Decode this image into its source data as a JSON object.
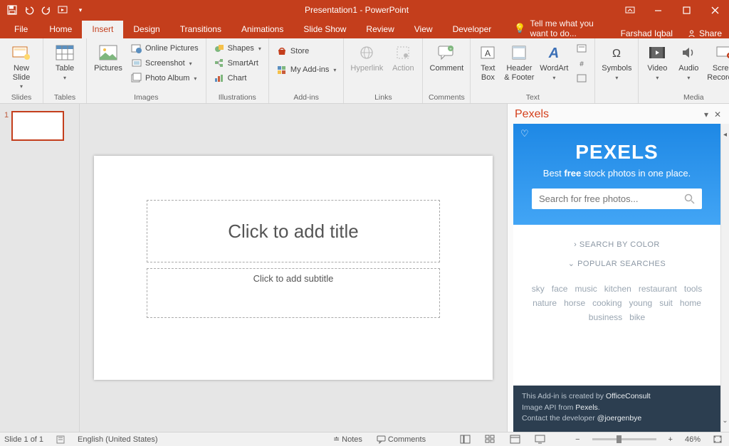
{
  "title": "Presentation1 - PowerPoint",
  "qat": {
    "save": "",
    "undo": "",
    "redo": "",
    "start": ""
  },
  "win": {
    "ribopts": "▾"
  },
  "tabs": {
    "file": "File",
    "list": [
      {
        "label": "Home"
      },
      {
        "label": "Insert"
      },
      {
        "label": "Design"
      },
      {
        "label": "Transitions"
      },
      {
        "label": "Animations"
      },
      {
        "label": "Slide Show"
      },
      {
        "label": "Review"
      },
      {
        "label": "View"
      },
      {
        "label": "Developer"
      }
    ],
    "active": 1,
    "tellme": "Tell me what you want to do...",
    "user": "Farshad Iqbal",
    "share": "Share"
  },
  "ribbon": {
    "slides": {
      "label": "Slides",
      "newSlide": "New Slide"
    },
    "tables": {
      "label": "Tables",
      "table": "Table"
    },
    "images": {
      "label": "Images",
      "pictures": "Pictures",
      "online": "Online Pictures",
      "screenshot": "Screenshot",
      "album": "Photo Album"
    },
    "illus": {
      "label": "Illustrations",
      "shapes": "Shapes",
      "smartart": "SmartArt",
      "chart": "Chart"
    },
    "addins": {
      "label": "Add-ins",
      "store": "Store",
      "myaddins": "My Add-ins"
    },
    "links": {
      "label": "Links",
      "hyperlink": "Hyperlink",
      "action": "Action"
    },
    "comments": {
      "label": "Comments",
      "comment": "Comment"
    },
    "text": {
      "label": "Text",
      "textbox": "Text Box",
      "hf": "Header & Footer",
      "wordart": "WordArt"
    },
    "symbols": {
      "label": "",
      "symbols": "Symbols"
    },
    "media": {
      "label": "Media",
      "video": "Video",
      "audio": "Audio",
      "screenrec": "Screen Recording"
    }
  },
  "thumbs": {
    "items": [
      {
        "num": "1"
      }
    ]
  },
  "slide": {
    "title_ph": "Click to add title",
    "sub_ph": "Click to add subtitle"
  },
  "pane": {
    "title": "Pexels",
    "hero_logo": "PEXELS",
    "hero_tag_pre": "Best ",
    "hero_tag_bold": "free",
    "hero_tag_post": " stock photos in one place.",
    "search_ph": "Search for free photos...",
    "link_color": "SEARCH BY COLOR",
    "link_popular": "POPULAR SEARCHES",
    "tags": [
      "sky",
      "face",
      "music",
      "kitchen",
      "restaurant",
      "tools",
      "nature",
      "horse",
      "cooking",
      "young",
      "suit",
      "home",
      "business",
      "bike"
    ],
    "footer_line1_a": "This Add-in is created by ",
    "footer_line1_b": "OfficeConsult",
    "footer_line2_a": "Image API from ",
    "footer_line2_b": "Pexels",
    "footer_line2_c": ".",
    "footer_line3_a": "Contact the developer ",
    "footer_line3_b": "@joergenbye"
  },
  "status": {
    "slide": "Slide 1 of 1",
    "lang": "English (United States)",
    "notes": "Notes",
    "comments": "Comments",
    "zoom": "46%"
  }
}
